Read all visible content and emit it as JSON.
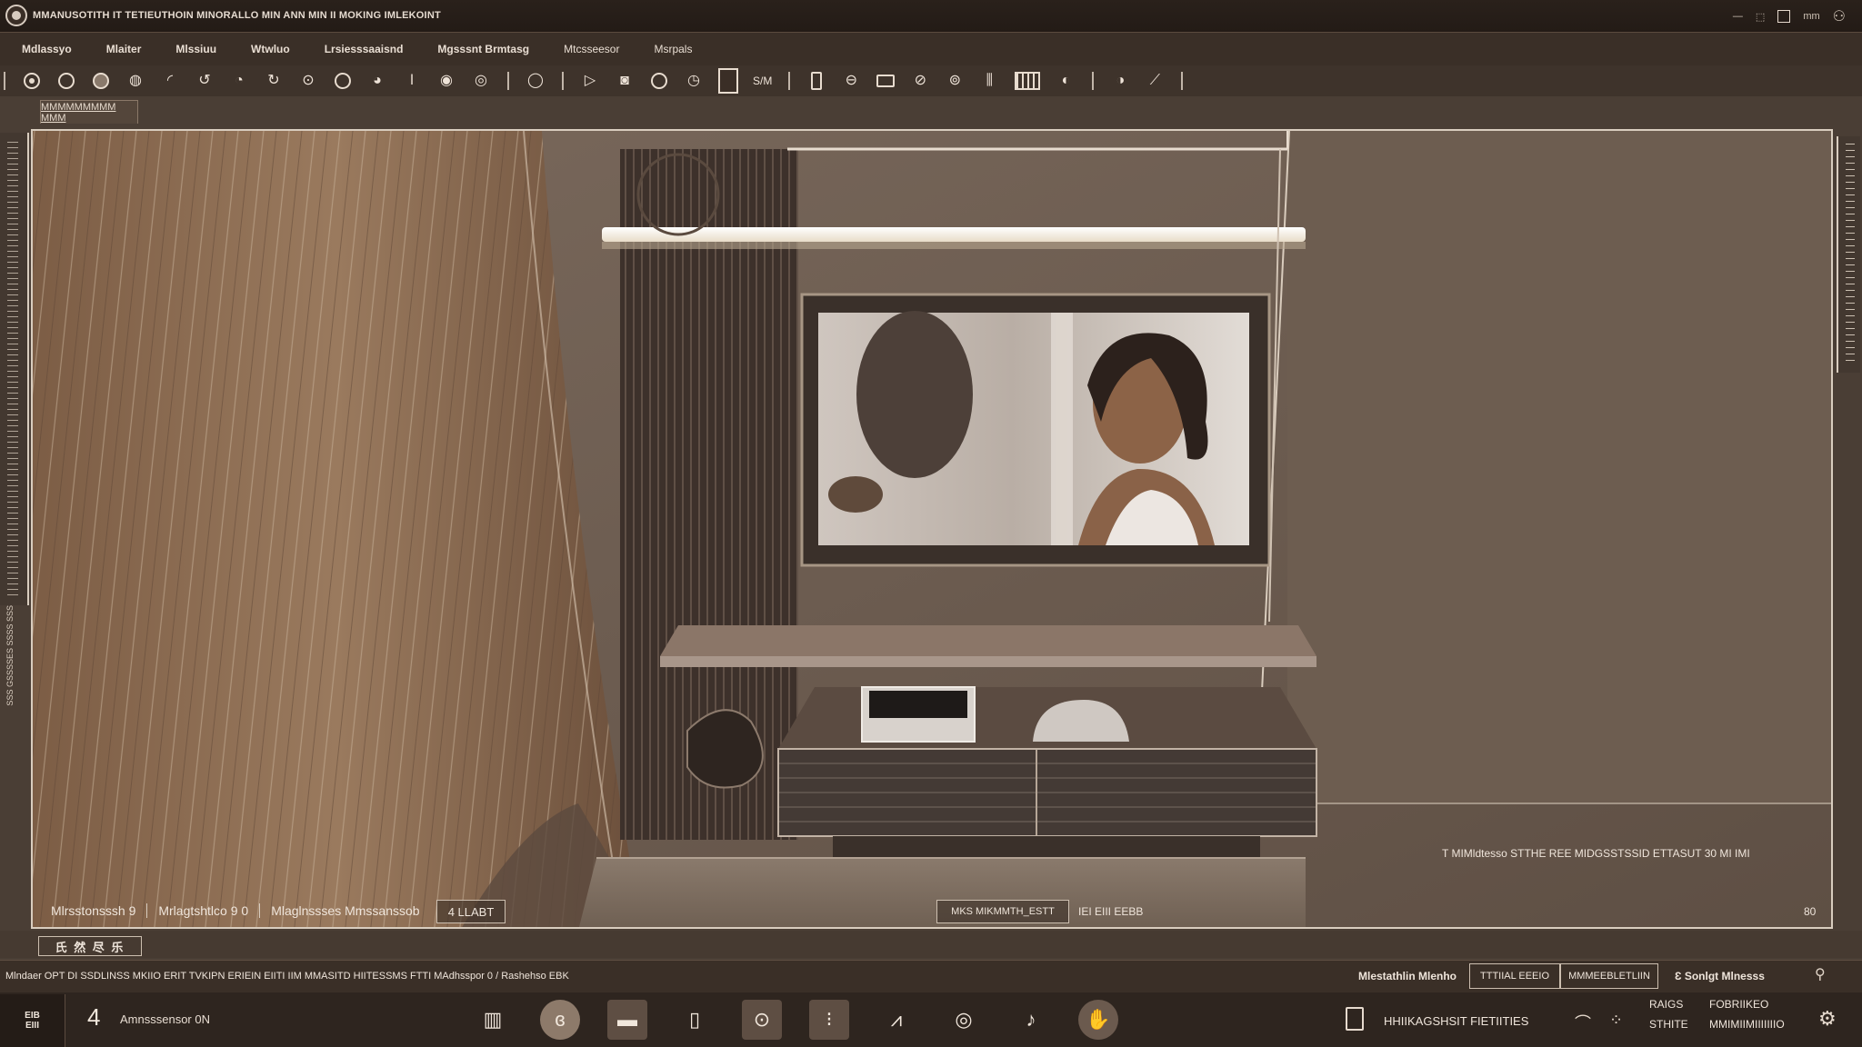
{
  "window": {
    "title": "MMANUSOTITH IT TETIEUTHOIN MINORALLO MIN ANN MIN II MOKING IMLEKOINT",
    "controls": [
      "—",
      "⬚",
      "▮",
      "mm"
    ]
  },
  "menu": [
    "Mdlassyo",
    "Mlaiter",
    "Mlssiuu",
    "Wtwluo",
    "Lrsiesssaaisnd",
    "Mgsssnt Brmtasg",
    "Mtcsseesor",
    "Msrpals"
  ],
  "toolbar": {
    "text_label": "S/M"
  },
  "view_tab": {
    "label": "MMMMMMMMM MMM"
  },
  "left_ruler": {
    "label": "SSS GSSSSES SSSS SSS"
  },
  "scene": {
    "caption": "T MIMldtesso STTHE REE MIDGSSTSSID ETTASUT 30 MI IMI",
    "colors": {
      "wall": "#6f5f52",
      "panel_wood": "#8d6d52",
      "shelf": "#7a6658",
      "cabinet": "#4a413c",
      "light_strip": "#f7eee0"
    }
  },
  "viewport_status": {
    "segments": [
      "Mlrsstonsssh 9",
      "Mrlagtshtlco 9  0",
      "Mlaglnssses Mmssanssob"
    ],
    "tag": "4 LLABT",
    "mid_box": "MKS MIKMMTH_ESTT",
    "mid_text": "IEI   EIII EEBB",
    "zoom": "80"
  },
  "layer_chips": {
    "label": "氏 然 尽 乐"
  },
  "info": {
    "left": "Mlndaer OPT DI  SSDLINSS  MKIIO ERIT TVKIPN ERIEIN EIITI IIM   MMASITD  HIITESSMS  FTTI MAdhsspor  0  /  Rashehso EBK",
    "right_label": "Mlestathlin Mlenho",
    "tab1": "TTTIIAL EEEIO",
    "tab2": "MMMEEBLETLIIN",
    "right_label2": "Ɛ  Sonlgt Mlnesss"
  },
  "dock": {
    "badge_line1": "EIB",
    "badge_line2": "EIII",
    "count": "4",
    "count_label": "Amnsssensor 0N",
    "right_text": "HHIIKAGSHSIT FIETIITIES",
    "grid": [
      "RAIGS",
      "FOBRIIKEO",
      "STHITE",
      "MMIMIIMIIIIIIIO"
    ]
  }
}
